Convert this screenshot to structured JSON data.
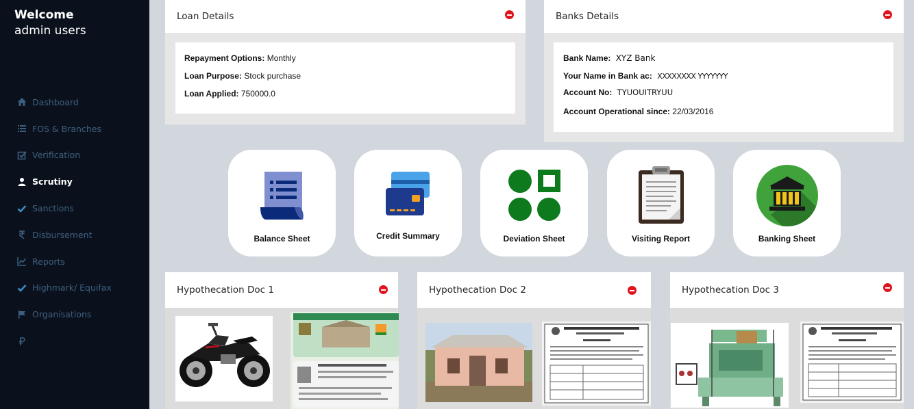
{
  "sidebar": {
    "welcome": "Welcome",
    "user": "admin users",
    "items": [
      {
        "label": "Dashboard",
        "icon": "home-icon"
      },
      {
        "label": "FOS & Branches",
        "icon": "list-icon"
      },
      {
        "label": "Verification",
        "icon": "check-square-icon"
      },
      {
        "label": "Scrutiny",
        "icon": "user-icon",
        "active": true
      },
      {
        "label": "Sanctions",
        "icon": "check-icon"
      },
      {
        "label": "Disbursement",
        "icon": "rupee-icon"
      },
      {
        "label": "Reports",
        "icon": "line-chart-icon"
      },
      {
        "label": "Highmark/ Equifax",
        "icon": "check-icon"
      },
      {
        "label": "Organisations",
        "icon": "flag-icon"
      },
      {
        "label": "",
        "icon": "ruble-icon"
      }
    ]
  },
  "loan": {
    "title": "Loan Details",
    "repayment_label": "Repayment Options:",
    "repayment_value": "Monthly",
    "purpose_label": "Loan Purpose:",
    "purpose_value": "Stock purchase",
    "applied_label": "Loan Applied:",
    "applied_value": "750000.0"
  },
  "bank": {
    "title": "Banks Details",
    "name_label": "Bank Name:",
    "name_value": "XYZ Bank",
    "acname_label": "Your Name in Bank ac:",
    "acname_value": "XXXXXXXX YYYYYYY",
    "acno_label": "Account No:",
    "acno_value": "TYUOUITRYUU",
    "since_label": "Account Operational since:",
    "since_value": "22/03/2016"
  },
  "tiles": [
    {
      "label": "Balance Sheet",
      "icon": "balance-sheet-icon"
    },
    {
      "label": "Credit Summary",
      "icon": "credit-card-icon"
    },
    {
      "label": "Deviation Sheet",
      "icon": "deviation-grid-icon"
    },
    {
      "label": "Visiting Report",
      "icon": "clipboard-icon"
    },
    {
      "label": "Banking Sheet",
      "icon": "bank-icon"
    }
  ],
  "docs": [
    {
      "title": "Hypothecation Doc 1",
      "images": [
        "motorcycle-image",
        "registration-card-image"
      ]
    },
    {
      "title": "Hypothecation Doc 2",
      "images": [
        "house-image",
        "certificate-image"
      ]
    },
    {
      "title": "Hypothecation Doc 3",
      "images": [
        "loom-machine-image",
        "certificate-image"
      ]
    }
  ],
  "colors": {
    "sidebar_bg": "#0b111c",
    "nav_text": "#3d5f7f",
    "page_bg": "#d2d7de",
    "remove_red": "#e0141e",
    "deviation_green": "#0e7a1e",
    "bank_green": "#3fa23a"
  }
}
